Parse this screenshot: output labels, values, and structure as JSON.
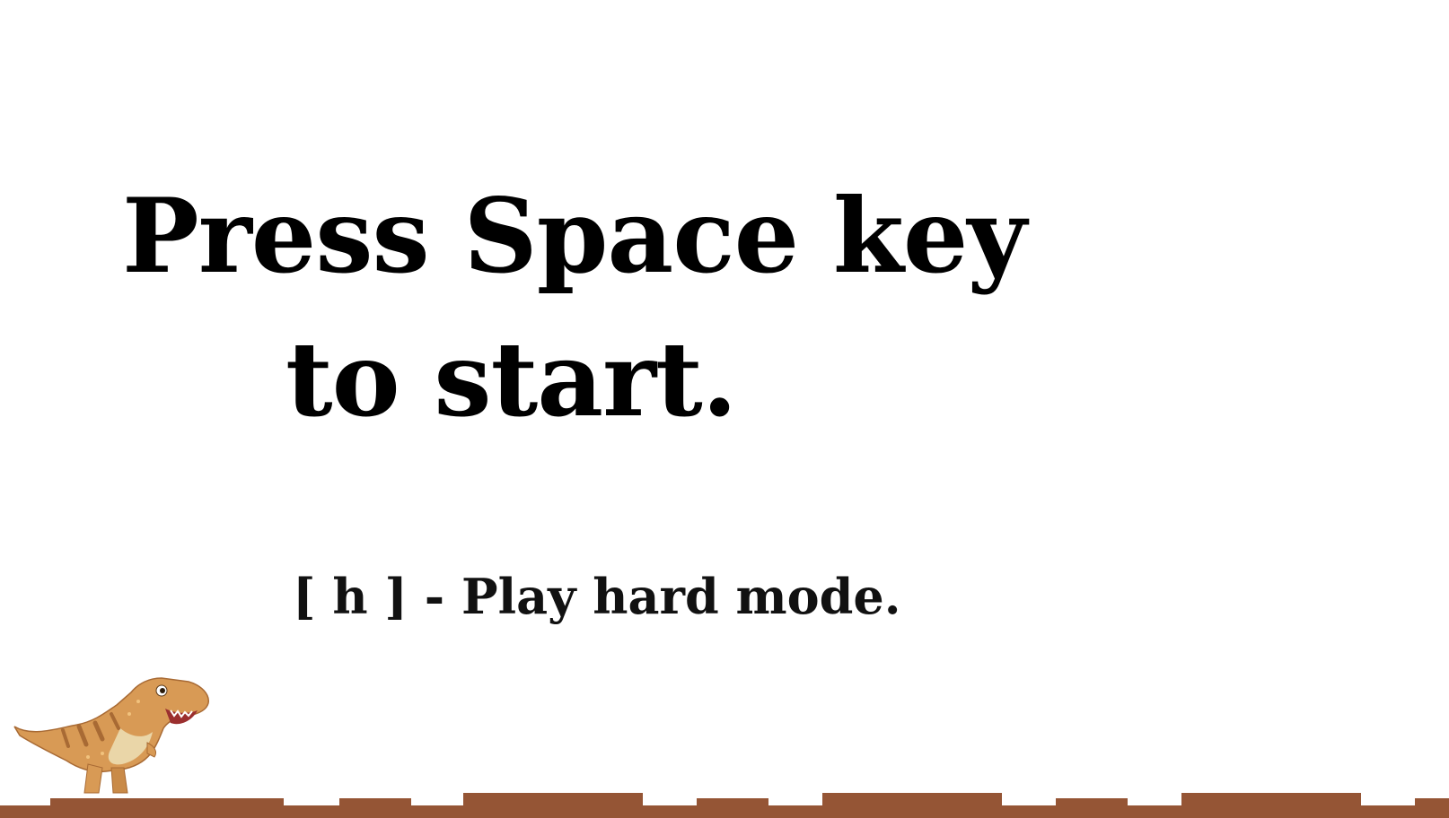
{
  "screen": {
    "title_line_1": "Press Space key",
    "title_line_2": "to start.",
    "hint": "[ h ] - Play hard mode."
  },
  "colors": {
    "background": "#ffffff",
    "text": "#000000",
    "ground": "#955535",
    "dino_body": "#d89a55",
    "dino_belly": "#ead6a8",
    "dino_stripe": "#a86a34"
  },
  "icons": {
    "player": "t-rex-dinosaur",
    "ground": "brick-ground-strip"
  }
}
